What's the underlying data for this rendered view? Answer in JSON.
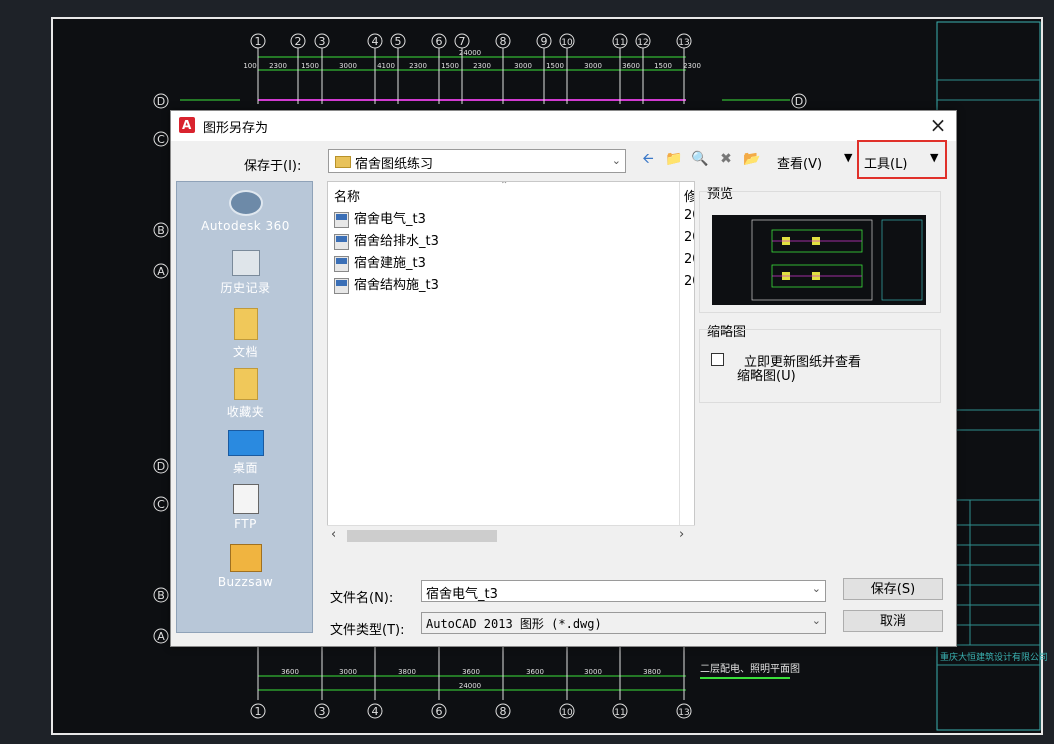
{
  "background": {
    "grid_numbers_top": [
      "1",
      "2",
      "3",
      "4",
      "5",
      "6",
      "7",
      "8",
      "9",
      "10",
      "11",
      "12",
      "13"
    ],
    "grid_numbers_bottom": [
      "1",
      "3",
      "4",
      "6",
      "8",
      "10",
      "11",
      "13"
    ],
    "grid_letters_left": [
      "D",
      "C",
      "B",
      "A",
      "D",
      "C",
      "B",
      "A"
    ],
    "top_dims": [
      "100",
      "2300",
      "1500",
      "3000",
      "4100",
      "2300",
      "1500",
      "2300",
      "3000",
      "1500",
      "3000",
      "3600",
      "1500",
      "2300"
    ],
    "top_total": "24000",
    "bottom_dims": [
      "3600",
      "3000",
      "3800",
      "3600",
      "3600",
      "3000",
      "3800",
      "3600"
    ],
    "bottom_total": "24000",
    "drawing_caption": "二层配电、照明平面图",
    "title_block_company": "重庆大恒建筑设计有限公司"
  },
  "dialog": {
    "title": "图形另存为",
    "close_icon": "×",
    "save_in_label": "保存于(I):",
    "save_in_value": "宿舍图纸练习",
    "view_label": "查看(V)",
    "tools_label": "工具(L)",
    "places": [
      {
        "label": "Autodesk 360",
        "icon": "cloud-icon"
      },
      {
        "label": "历史记录",
        "icon": "history-icon"
      },
      {
        "label": "文档",
        "icon": "documents-icon"
      },
      {
        "label": "收藏夹",
        "icon": "favorites-icon"
      },
      {
        "label": "桌面",
        "icon": "desktop-icon"
      },
      {
        "label": "FTP",
        "icon": "ftp-icon"
      },
      {
        "label": "Buzzsaw",
        "icon": "buzzsaw-icon"
      }
    ],
    "columns": {
      "name": "名称",
      "modified": "修"
    },
    "files": [
      {
        "name": "宿舍电气_t3",
        "modified": "20"
      },
      {
        "name": "宿舍给排水_t3",
        "modified": "20"
      },
      {
        "name": "宿舍建施_t3",
        "modified": "20"
      },
      {
        "name": "宿舍结构施_t3",
        "modified": "20"
      }
    ],
    "preview_label": "预览",
    "thumbnail_label": "缩略图",
    "update_thumb_line1": "立即更新图纸并查看",
    "update_thumb_line2": "缩略图(U)",
    "filename_label": "文件名(N):",
    "filename_value": "宿舍电气_t3",
    "filetype_label": "文件类型(T):",
    "filetype_value": "AutoCAD 2013 图形 (*.dwg)",
    "save_button": "保存(S)",
    "cancel_button": "取消"
  }
}
